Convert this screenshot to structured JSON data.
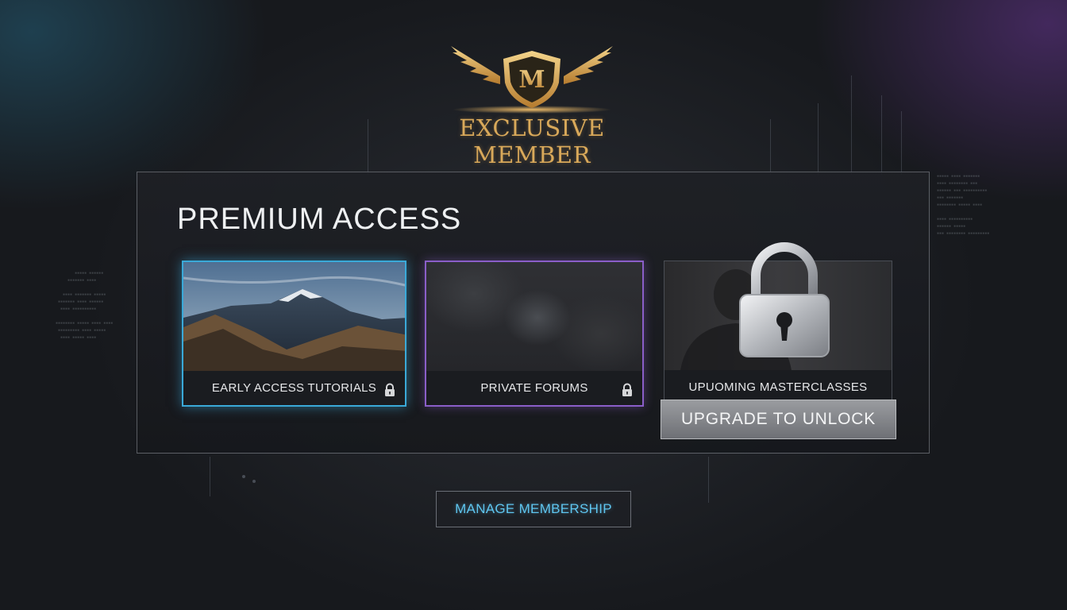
{
  "brand": {
    "logo_letter": "M",
    "logo_text": "EXCLUSIVE MEMBER",
    "gold": "#d9a95a"
  },
  "panel": {
    "title": "PREMIUM ACCESS",
    "cards": [
      {
        "label": "EARLY ACCESS TUTORIALS",
        "locked_icon": "lock-icon",
        "accent": "#3aa9d8"
      },
      {
        "label": "PRIVATE FORUMS",
        "locked_icon": "lock-icon",
        "accent": "#8a5ec8"
      },
      {
        "label": "UPUOMING MASTERCLASSES",
        "locked_icon": "padlock-icon"
      }
    ],
    "upgrade_label": "UPGRADE TO UNLOCK"
  },
  "manage_label": "MANAGE MEMBERSHIP",
  "accent_blue": "#5fc6f0"
}
